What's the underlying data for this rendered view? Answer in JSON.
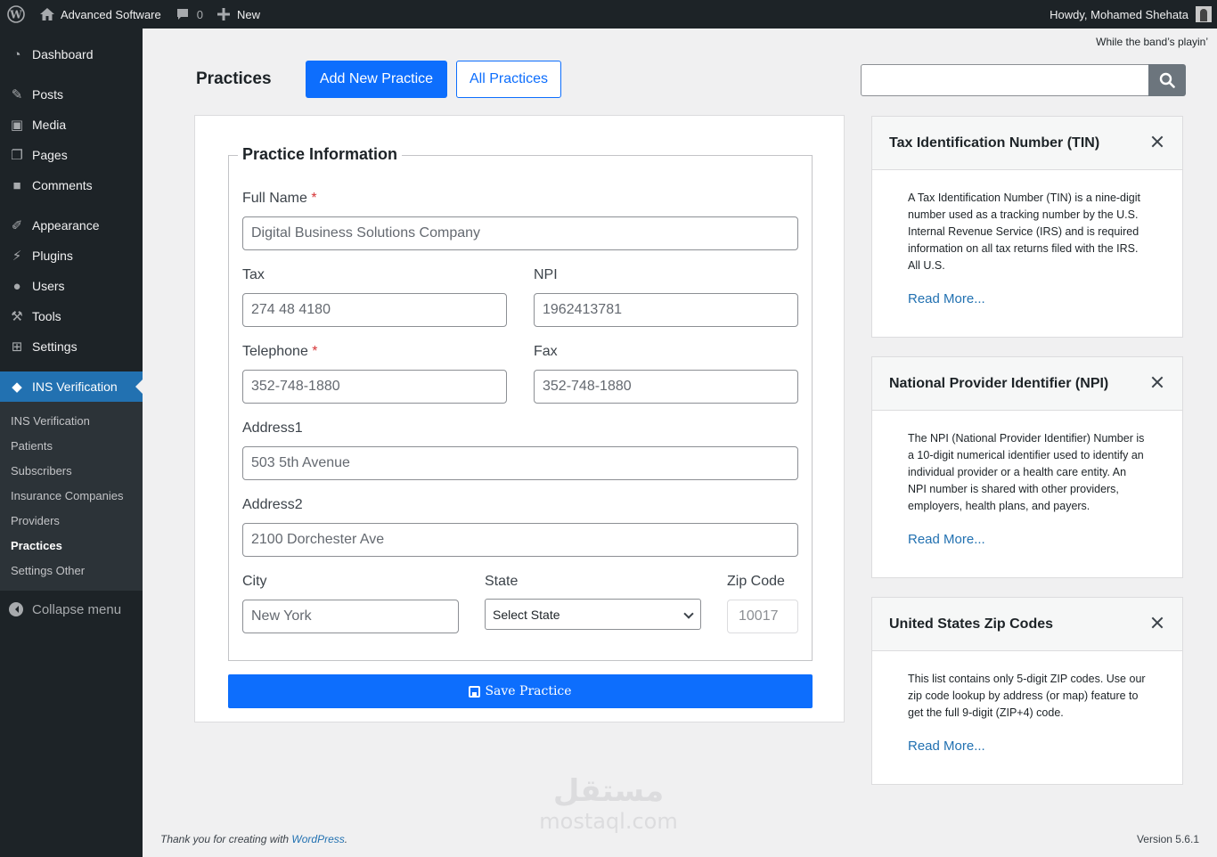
{
  "adminbar": {
    "site_name": "Advanced Software",
    "comments_count": "0",
    "new_label": "New",
    "howdy": "Howdy, Mohamed Shehata"
  },
  "sidebar": {
    "items": [
      {
        "label": "Dashboard",
        "icon": "dashboard-icon"
      },
      {
        "label": "Posts",
        "icon": "pin-icon"
      },
      {
        "label": "Media",
        "icon": "media-icon"
      },
      {
        "label": "Pages",
        "icon": "pages-icon"
      },
      {
        "label": "Comments",
        "icon": "comment-icon"
      },
      {
        "label": "Appearance",
        "icon": "brush-icon"
      },
      {
        "label": "Plugins",
        "icon": "plug-icon"
      },
      {
        "label": "Users",
        "icon": "user-icon"
      },
      {
        "label": "Tools",
        "icon": "wrench-icon"
      },
      {
        "label": "Settings",
        "icon": "settings-icon"
      }
    ],
    "active_item": "INS Verification",
    "submenu": [
      "INS Verification",
      "Patients",
      "Subscribers",
      "Insurance Companies",
      "Providers",
      "Practices",
      "Settings Other"
    ],
    "current_sub": "Practices",
    "collapse_label": "Collapse menu"
  },
  "tagline": "While the band’s playin’",
  "header": {
    "title": "Practices",
    "add_new": "Add New Practice",
    "all": "All Practices"
  },
  "form": {
    "legend": "Practice Information",
    "full_name_label": "Full Name",
    "full_name_placeholder": "Digital Business Solutions Company",
    "tax_label": "Tax",
    "tax_placeholder": "274 48 4180",
    "npi_label": "NPI",
    "npi_placeholder": "1962413781",
    "telephone_label": "Telephone",
    "telephone_placeholder": "352-748-1880",
    "fax_label": "Fax",
    "fax_placeholder": "352-748-1880",
    "address1_label": "Address1",
    "address1_placeholder": "503 5th Avenue",
    "address2_label": "Address2",
    "address2_placeholder": "2100 Dorchester Ave",
    "city_label": "City",
    "city_placeholder": "New York",
    "state_label": "State",
    "state_value": "Select State",
    "zip_label": "Zip Code",
    "zip_value": "10017",
    "required_mark": "*",
    "save_label": "Save Practice"
  },
  "cards": [
    {
      "title": "Tax Identification Number (TIN)",
      "body": "A Tax Identification Number (TIN) is a nine-digit number used as a tracking number by the U.S. Internal Revenue Service (IRS) and is required information on all tax returns filed with the IRS. All U.S.",
      "more": "Read More..."
    },
    {
      "title": "National Provider Identifier (NPI)",
      "body": "The NPI (National Provider Identifier) Number is a 10-digit numerical identifier used to identify an individual provider or a health care entity. An NPI number is shared with other providers, employers, health plans, and payers.",
      "more": "Read More..."
    },
    {
      "title": "United States Zip Codes",
      "body": "This list contains only 5-digit ZIP codes. Use our zip code lookup by address (or map) feature to get the full 9-digit (ZIP+4) code.",
      "more": "Read More..."
    }
  ],
  "watermark": {
    "arabic": "مستقل",
    "latin": "mostaql.com"
  },
  "footer": {
    "thanks_prefix": "Thank you for creating with",
    "wp_link": "WordPress",
    "period": ".",
    "version": "Version 5.6.1"
  },
  "colors": {
    "accent": "#0d6efd",
    "admin_dark": "#1d2327",
    "wp_blue": "#2271b1"
  }
}
